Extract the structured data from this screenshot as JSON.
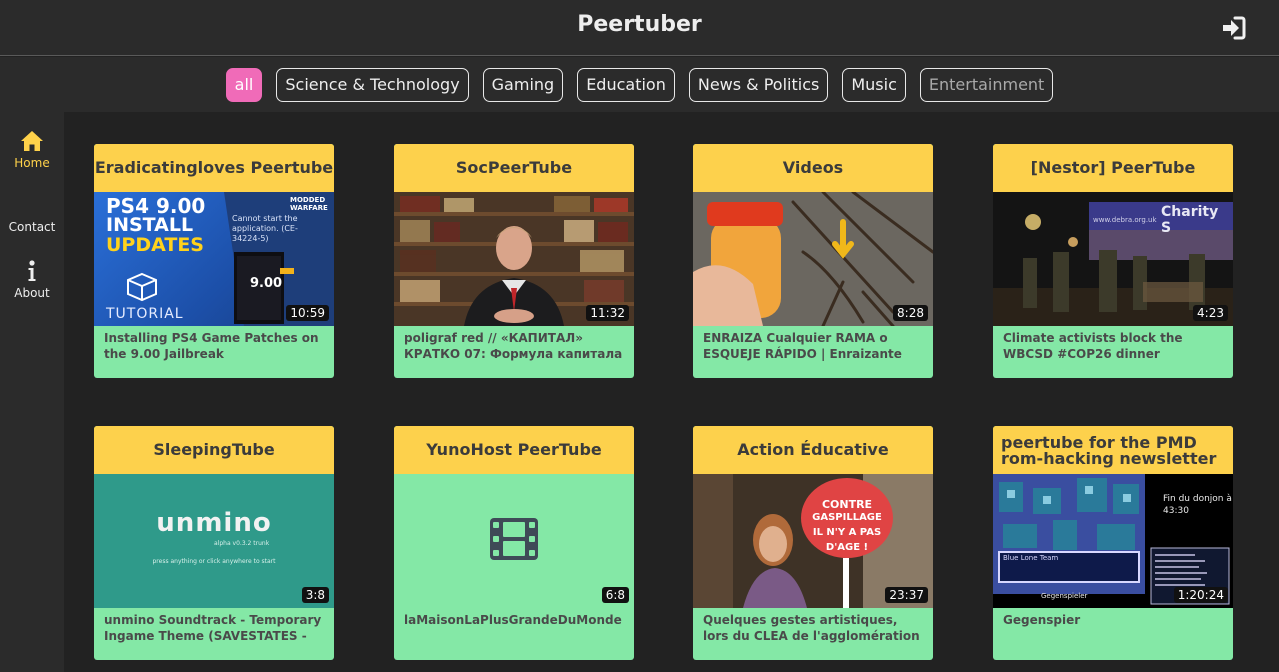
{
  "header": {
    "title": "Peertuber",
    "login_icon": "sign-in-icon"
  },
  "categories": [
    {
      "label": "all",
      "active": true
    },
    {
      "label": "Science & Technology"
    },
    {
      "label": "Gaming"
    },
    {
      "label": "Education"
    },
    {
      "label": "News & Politics"
    },
    {
      "label": "Music"
    },
    {
      "label": "Entertainment"
    }
  ],
  "sidebar": {
    "items": [
      {
        "label": "Home",
        "icon": "home-icon",
        "active": true
      },
      {
        "label": "Contact"
      },
      {
        "label": "About",
        "icon": "info-icon"
      }
    ]
  },
  "videos": [
    {
      "instance": "Eradicatingloves Peertube",
      "title": "Installing PS4 Game Patches on the 9.00 Jailbreak",
      "duration": "10:59",
      "thumb_text": {
        "a": "PS4 9.00",
        "b": "INSTALL",
        "c": "UPDATES",
        "d": "TUTORIAL",
        "e": "Cannot start the application. (CE-34224-5)",
        "f": "MODDED WARFARE",
        "g": "9.00"
      }
    },
    {
      "instance": "SocPeerTube",
      "title": "poligraf red // «КАПИТАЛ» КРАТКО 07: Формула капитала",
      "duration": "11:32"
    },
    {
      "instance": "Videos",
      "title": "ENRAIZA Cualquier RAMA o ESQUEJE RÁPIDO | Enraizante",
      "duration": "8:28"
    },
    {
      "instance": "[Nestor] PeerTube",
      "title": "Climate activists block the WBCSD #COP26 dinner",
      "duration": "4:23",
      "thumb_text": {
        "a": "Charity S",
        "b": "www.debra.org.uk"
      }
    },
    {
      "instance": "SleepingTube",
      "title": "unmino Soundtrack - Temporary Ingame Theme (SAVESTATES -",
      "duration": "3:8",
      "thumb_text": {
        "a": "unmino",
        "b": "alpha v0.3.2 trunk",
        "c": "press anything or click anywhere to start"
      }
    },
    {
      "instance": "YunoHost PeerTube",
      "title": "laMaisonLaPlusGrandeDuMonde",
      "duration": "6:8",
      "thumb_icon": "film-icon"
    },
    {
      "instance": "Action Éducative",
      "title": "Quelques gestes artistiques, lors du CLEA de l'agglomération Lens-",
      "duration": "23:37",
      "thumb_text": {
        "a": "CONTRE",
        "b": "GASPILLAGE",
        "c": "IL N'Y A PAS",
        "d": "D'AGE !"
      }
    },
    {
      "instance": "peertube for the PMD rom-hacking newsletter",
      "title": "Gegenspier",
      "duration": "1:20:24",
      "thumb_text": {
        "a": "Fin du donjon à",
        "b": "43:30",
        "c": "Gegenspieler",
        "d": "Blue Lone Team"
      }
    }
  ],
  "colors": {
    "accent_pink": "#f06bb8",
    "card_header": "#fdd14c",
    "card_body": "#84e8a6",
    "active_nav": "#ffd24a"
  }
}
